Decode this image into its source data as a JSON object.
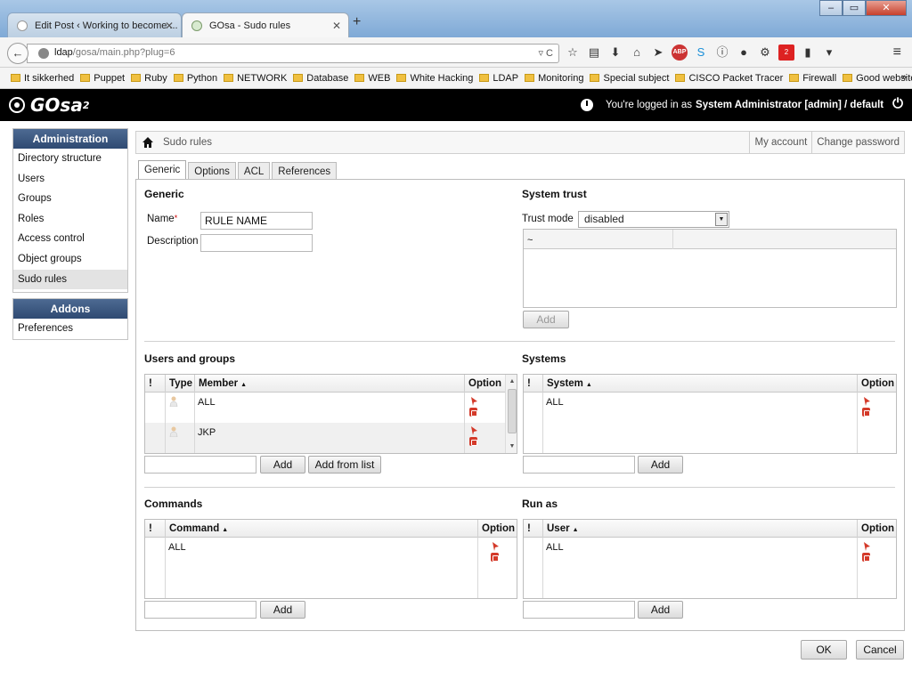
{
  "browser": {
    "tabs": [
      {
        "title": "Edit Post ‹ Working to become ...",
        "active": false
      },
      {
        "title": "GOsa - Sudo rules",
        "active": true
      }
    ],
    "url_host": "ldap",
    "url_path": "/gosa/main.php?plug=6",
    "bookmarks": [
      "It sikkerhed",
      "Puppet",
      "Ruby",
      "Python",
      "NETWORK",
      "Database",
      "WEB",
      "White Hacking",
      "LDAP",
      "Monitoring",
      "Special subject",
      "CISCO Packet Tracer",
      "Firewall",
      "Good websites"
    ],
    "notification_count": "2"
  },
  "header": {
    "logo": "GOsa",
    "logo_sup": "2",
    "login_prefix": "You're logged in as",
    "login_user": "System Administrator [admin] / default"
  },
  "sidebar": {
    "admin_title": "Administration",
    "admin_items": [
      "Directory structure",
      "Users",
      "Groups",
      "Roles",
      "Access control",
      "Object groups",
      "Sudo rules"
    ],
    "selected": "Sudo rules",
    "addons_title": "Addons",
    "addons_items": [
      "Preferences"
    ]
  },
  "breadcrumb": {
    "title": "Sudo rules",
    "my_account": "My account",
    "change_password": "Change password"
  },
  "tabs": [
    "Generic",
    "Options",
    "ACL",
    "References"
  ],
  "generic": {
    "title": "Generic",
    "name_label": "Name",
    "name_value": "RULE NAME",
    "description_label": "Description",
    "description_value": ""
  },
  "system_trust": {
    "title": "System trust",
    "trust_mode_label": "Trust mode",
    "trust_mode_value": "disabled",
    "list_first": "~",
    "add_label": "Add"
  },
  "users_groups": {
    "title": "Users and groups",
    "col_excl": "!",
    "col_type": "Type",
    "col_member": "Member",
    "col_option": "Option",
    "rows": [
      "ALL",
      "JKP"
    ],
    "add_label": "Add",
    "add_from_list_label": "Add from list"
  },
  "systems": {
    "title": "Systems",
    "col_excl": "!",
    "col_system": "System",
    "col_option": "Option",
    "rows": [
      "ALL"
    ],
    "add_label": "Add"
  },
  "commands": {
    "title": "Commands",
    "col_excl": "!",
    "col_command": "Command",
    "col_option": "Option",
    "rows": [
      "ALL"
    ],
    "add_label": "Add"
  },
  "run_as": {
    "title": "Run as",
    "col_excl": "!",
    "col_user": "User",
    "col_option": "Option",
    "rows": [
      "ALL"
    ],
    "add_label": "Add"
  },
  "footer": {
    "ok_label": "OK",
    "cancel_label": "Cancel"
  },
  "colors": {
    "sidebar_header": "#2f4a72",
    "delete_icon": "#d43a2a",
    "header_bg": "#000000"
  }
}
